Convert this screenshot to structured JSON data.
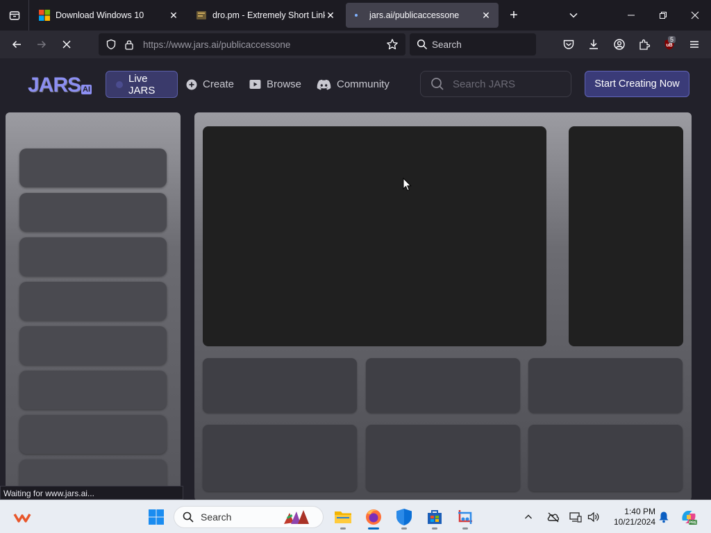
{
  "browser": {
    "tabs": [
      {
        "title": "Download Windows 10",
        "active": false
      },
      {
        "title": "dro.pm - Extremely Short Links",
        "active": false
      },
      {
        "title": "jars.ai/publicaccessone",
        "active": true
      }
    ],
    "url": "https://www.jars.ai/publicaccessone",
    "search_placeholder": "Search",
    "extension_badge": "5",
    "status_text": "Waiting for www.jars.ai..."
  },
  "site": {
    "logo_text": "JARS",
    "logo_suffix": "AI",
    "nav": {
      "live": "Live JARS",
      "create": "Create",
      "browse": "Browse",
      "community": "Community"
    },
    "search_placeholder": "Search JARS",
    "cta": "Start Creating Now"
  },
  "taskbar": {
    "search_label": "Search",
    "time": "1:40 PM",
    "date": "10/21/2024"
  },
  "colors": {
    "accent": "#8c8ff2",
    "cta_bg": "#3a3b78",
    "page_bg": "#22212a"
  }
}
